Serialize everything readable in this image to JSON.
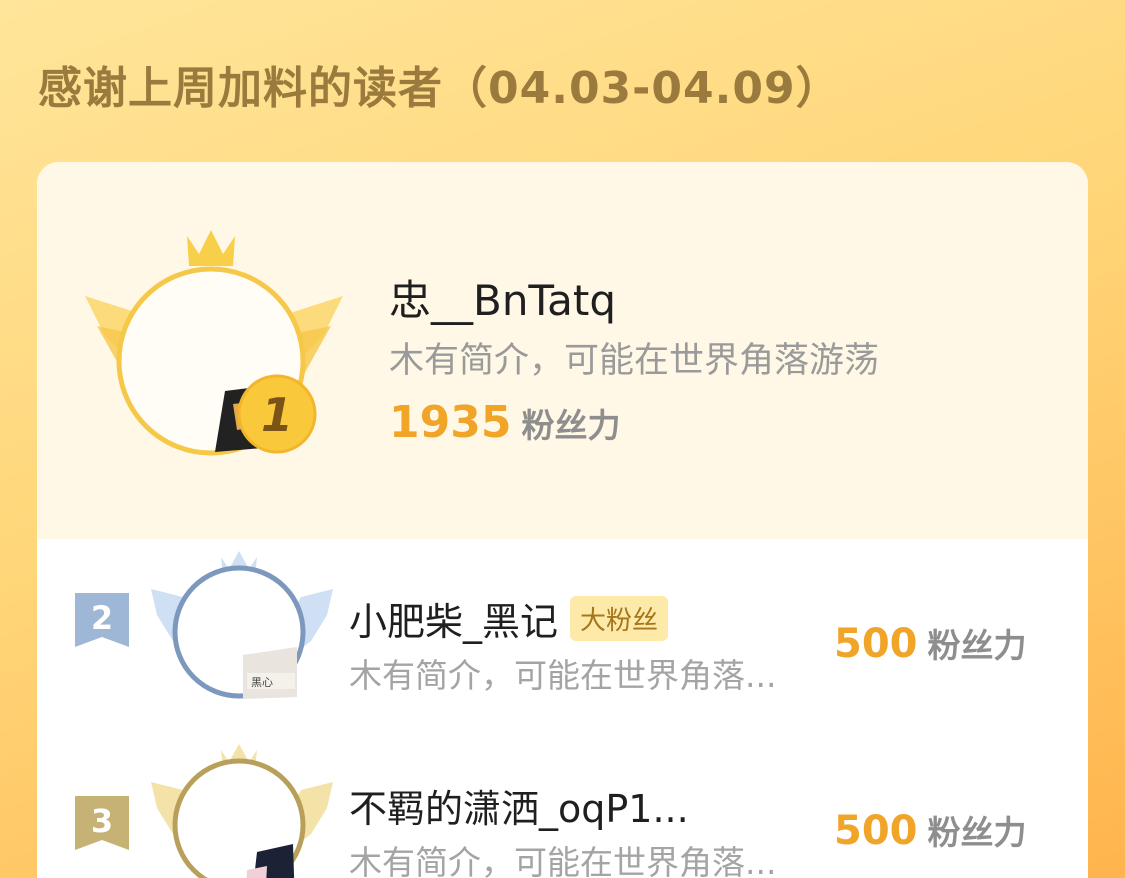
{
  "header": {
    "title": "感谢上周加料的读者（04.03-04.09）"
  },
  "ranking": {
    "first": {
      "rank": "1",
      "name": "忠__BnTatq",
      "bio": "木有简介，可能在世界角落游荡",
      "score": "1935",
      "score_unit": "粉丝力"
    },
    "others": [
      {
        "rank": "2",
        "name": "小肥柴_黑记",
        "tag": "大粉丝",
        "bio": "木有简介，可能在世界角落...",
        "score": "500",
        "score_unit": "粉丝力",
        "avatar_text": "黑心"
      },
      {
        "rank": "3",
        "name": "不羁的潇洒_oqP1...",
        "bio": "木有简介，可能在世界角落...",
        "score": "500",
        "score_unit": "粉丝力"
      }
    ]
  },
  "colors": {
    "gold": "#f0a428",
    "silver": "#7c98bd",
    "bronze": "#b9a05a",
    "heading": "#9b7a3e"
  }
}
